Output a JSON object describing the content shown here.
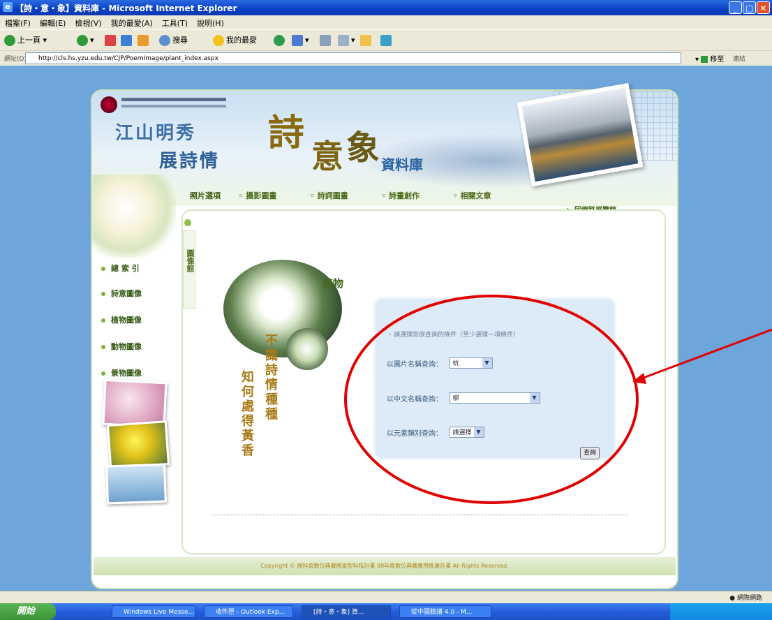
{
  "window": {
    "title": "【詩・意・象】資料庫 - Microsoft Internet Explorer",
    "menu": [
      "檔案(F)",
      "編輯(E)",
      "檢視(V)",
      "我的最愛(A)",
      "工具(T)",
      "說明(H)"
    ],
    "toolbar": {
      "back": "上一頁",
      "search": "搜尋",
      "favorites": "我的最愛"
    },
    "address_label": "網址(D)",
    "address_url": "http://cls.hs.yzu.edu.tw/CJP/PoemImage/plant_index.aspx",
    "go_label": "移至",
    "links_label": "連結"
  },
  "banner": {
    "line1": "江山明秀",
    "line2": "展詩情",
    "title_shi": "詩",
    "title_yi": "意",
    "title_xiang": "象",
    "subtitle": "資料庫"
  },
  "top_nav": [
    "照片選項",
    "攝影圖畫",
    "詩詞圖畫",
    "詩畫創作",
    "相關文章"
  ],
  "return_link": "回網路展覽館",
  "left_nav": [
    "總 索 引",
    "詩意圖像",
    "植物圖像",
    "動物圖像",
    "景物圖像"
  ],
  "vtab_label": "圖像館",
  "category_title": "植物",
  "poem_lines": [
    "不識詩情種種",
    "知何處得黃香"
  ],
  "search": {
    "hint": "請選擇您欲查詢的條件（至少選擇一項條件）",
    "fields": [
      {
        "label": "以圖片名稱查詢：",
        "value": "杭"
      },
      {
        "label": "以中文名稱查詢：",
        "value": "柳"
      },
      {
        "label": "以元素類別查詢：",
        "value": "請選擇"
      }
    ],
    "submit_label": "查詢"
  },
  "footer": "Copyright © 國科會數位典藏國家型科技計畫 98年度數位典藏應用推廣計畫 All Rights Reserved.",
  "status": {
    "zone": "網際網路"
  },
  "taskbar": {
    "start_label": "開始",
    "tasks": [
      "Windows Live Messe...",
      "收件匣 - Outlook Exp...",
      "[詩・意・象] 資...",
      "從中國臉譜 4.0 - M..."
    ]
  },
  "colors": {
    "accent_red": "#e10000",
    "panel_green": "#cfe2b3",
    "form_blue": "#dcebf7"
  }
}
